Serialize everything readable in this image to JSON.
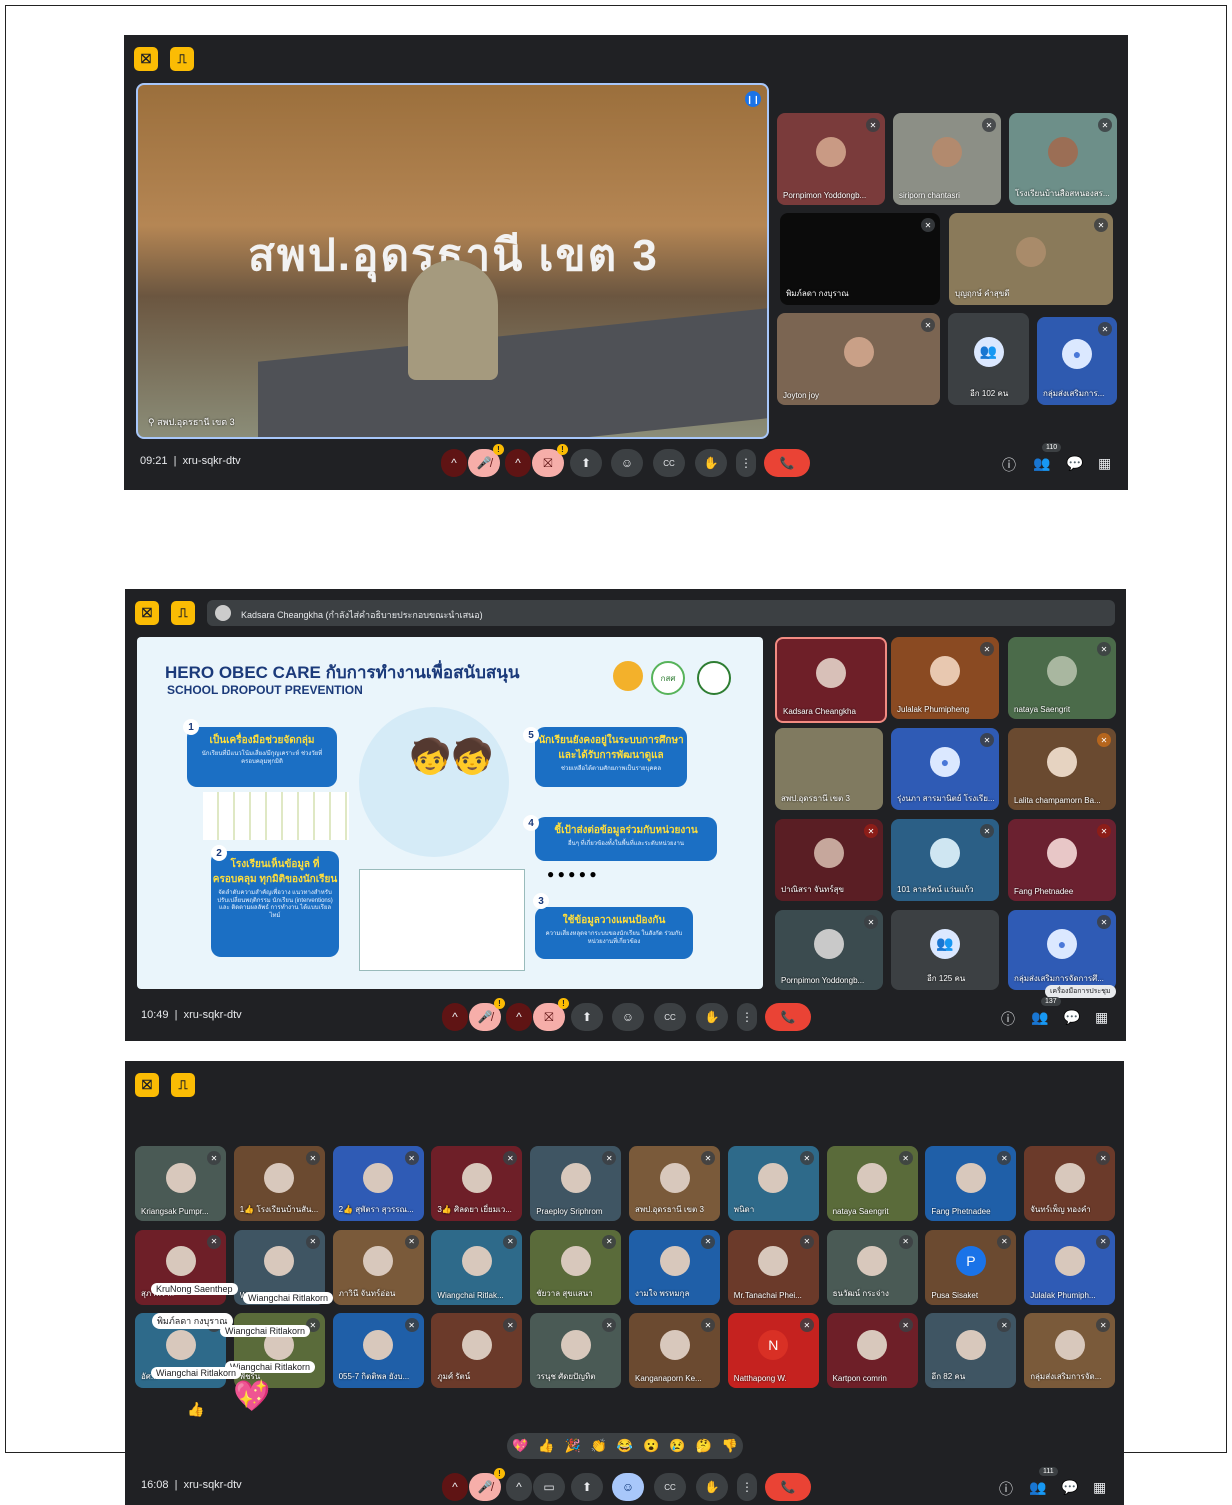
{
  "meeting_code": "xru-sqkr-dtv",
  "screens": [
    {
      "time": "09:21",
      "participant_count": "110",
      "main_speaker": "สพป.อุดรธานี เขต 3",
      "banner_text": "สพป.อุดรธานี เขต 3",
      "tiles": [
        "Pornpimon Yoddongb...",
        "siriporn chantasri",
        "โรงเรียนบ้านสือสหนองสร...",
        "พิมภ์ลดา กงบุราณ",
        "บุญฤกษ์ คำสุขดี",
        "Joyton joy",
        "อีก 102 คน",
        "กลุ่มส่งเสริมการ..."
      ]
    },
    {
      "time": "10:49",
      "participant_count": "137",
      "presenter_notice": "Kadsara Cheangkha (กำลังไส่คำอธิบายประกอบขณะนำเสนอ)",
      "tooltip": "เครื่องมือการประชุม",
      "slide": {
        "title_en": "HERO OBEC CARE",
        "title_th": "กับการทำงานเพื่อสนับสนุน",
        "subtitle": "SCHOOL DROPOUT PREVENTION",
        "logo_text": "กสศ",
        "steps": [
          {
            "n": "1",
            "title": "เป็นเครื่องมือช่วยจัดกลุ่ม",
            "desc": "นักเรียนที่มีแนวโน้มเสี่ยง/มีกุญเคราะห์ ช่วงวัยที่ครอบคลุมทุกมิติ"
          },
          {
            "n": "2",
            "title": "โรงเรียนเห็นข้อมูล ที่ครอบคลุม ทุกมิติของนักเรียน",
            "desc": "จัดลำดับความสำคัญเพื่อวาง แนวทางสำหรับปรับเปลี่ยนพฤติกรรม นักเรียน (interventions) และ ติดตามผลลัพธ์ การทำงาน ได้แบบเรียลไทม์"
          },
          {
            "n": "3",
            "title": "ใช้ข้อมูลวางแผนป้องกัน",
            "desc": "ความเสี่ยงหลุดจากระบบของนักเรียน ในสังกัด ร่วมกับหน่วยงานที่เกี่ยวข้อง"
          },
          {
            "n": "4",
            "title": "ชี้เป้าส่งต่อข้อมูลร่วมกับหน่วยงาน",
            "desc": "อื่นๆ ที่เกี่ยวข้องทั้งในพื้นที่และระดับหน่วยงาน"
          },
          {
            "n": "5",
            "title": "นักเรียนยังคงอยู่ในระบบการศึกษา และได้รับการพัฒนาดูแล",
            "desc": "ช่วยเหลือได้ตามศักยภาพเป็นรายบุคคล"
          }
        ]
      },
      "tiles": [
        "Kadsara Cheangkha",
        "Julalak Phumipheng",
        "nataya Saengrit",
        "สพป.อุดรธานี เขต 3",
        "รุ่งนภา สารมานิตย์ โรงเรีย...",
        "Lalita champamorn Ba...",
        "ปาณิสรา จันทร์สุข",
        "101 ลาลรัตน์ แว่นแก้ว",
        "Fang Phetnadee",
        "Pornpimon Yoddongb...",
        "อีก 125 คน",
        "กลุ่มส่งเสริมการจัดการศึ..."
      ]
    },
    {
      "time": "16:08",
      "participant_count": "111",
      "tiles_row1": [
        "Kriangsak Pumpr...",
        "1👍 โรงเรียนบ้านสัน...",
        "2👍 สุพัตรา สุวรรณ...",
        "3👍 ศิลดยา เยี่ยมเว...",
        "Praeploy Sriphrom",
        "สพป.อุดรธานี เขต 3",
        "พนิดา",
        "nataya Saengrit",
        "Fang Phetnadee",
        "จันทร์เพ็ญ ทองคำ"
      ],
      "tiles_row2": [
        "สุภาพร ...",
        "Wiangchai Ritlakorn",
        "ภาวินี จันทร์อ่อน",
        "Wiangchai Ritlak...",
        "ชัยวาล สุขแสนา",
        "งามใจ พรหมกุล",
        "Mr.Tanachai Phei...",
        "ธนวัฒน์ กระจ่าง",
        "Pusa Sisaket",
        "Julalak Phumiph..."
      ],
      "tiles_row3": [
        "อัศ...",
        "พัชริน",
        "055-7 กิตติพล ยังบ...",
        "ภูมศ์ รัตน์",
        "วรนุช ศัดยปัญทิต",
        "Kanganaporn Ke...",
        "Natthapong W.",
        "Kartpon comrin",
        "อีก 82 คน",
        "กลุ่มส่งเสริมการจัด..."
      ],
      "initial_p": "P",
      "initial_n": "N",
      "floating_names": [
        "KruNong Saenthep",
        "Wiangchai Ritlakorn",
        "พิมภ์ลดา กงบุราณ",
        "Wiangchai Ritlakorn",
        "Wiangchai Ritlakorn",
        "Wiangchai Ritlakorn",
        "Wiangchai Ritlakorn"
      ],
      "reactions": [
        "💖",
        "👍",
        "🎉",
        "👏",
        "😂",
        "😮",
        "😢",
        "🤔",
        "👎"
      ]
    }
  ],
  "icons": {
    "pin": "📍",
    "mic_off": "🎤",
    "cam_off": "📷",
    "present": "⬆",
    "emoji": "☺",
    "cc": "CC",
    "hand": "✋",
    "more": "⋮",
    "hangup": "📞",
    "info": "ⓘ",
    "people": "👥",
    "chat": "💬",
    "apps": "▦",
    "caret": "^"
  },
  "colors": {
    "meet_bg": "#202124",
    "yellow": "#fbbc04",
    "hangup": "#ea4335",
    "slide_blue": "#1b6fc4"
  }
}
